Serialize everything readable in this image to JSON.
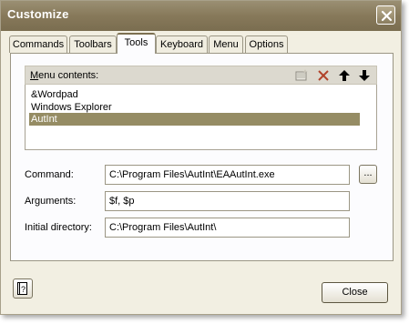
{
  "window": {
    "title": "Customize"
  },
  "tabs": [
    {
      "label": "Commands"
    },
    {
      "label": "Toolbars"
    },
    {
      "label": "Tools"
    },
    {
      "label": "Keyboard"
    },
    {
      "label": "Menu"
    },
    {
      "label": "Options"
    }
  ],
  "active_tab": "Tools",
  "menu_contents": {
    "label_accel": "M",
    "label_rest": "enu contents:",
    "toolbar_icons": [
      "new-item-icon",
      "delete-icon",
      "move-up-icon",
      "move-down-icon"
    ],
    "items": [
      {
        "label": "&Wordpad"
      },
      {
        "label": "Windows Explorer"
      },
      {
        "label": "AutInt",
        "selected": true
      }
    ]
  },
  "fields": {
    "command": {
      "label": "Command:",
      "value": "C:\\Program Files\\AutInt\\EAAutInt.exe"
    },
    "arguments": {
      "label": "Arguments:",
      "value": "$f, $p"
    },
    "initial_directory": {
      "label": "Initial directory:",
      "value": "C:\\Program Files\\AutInt\\"
    }
  },
  "browse_button": {
    "label": "..."
  },
  "footer": {
    "close_label": "Close",
    "help_icon": "help-icon"
  },
  "colors": {
    "titlebar": "#87795a",
    "selection": "#958c64",
    "dialog": "#f2efe2"
  }
}
